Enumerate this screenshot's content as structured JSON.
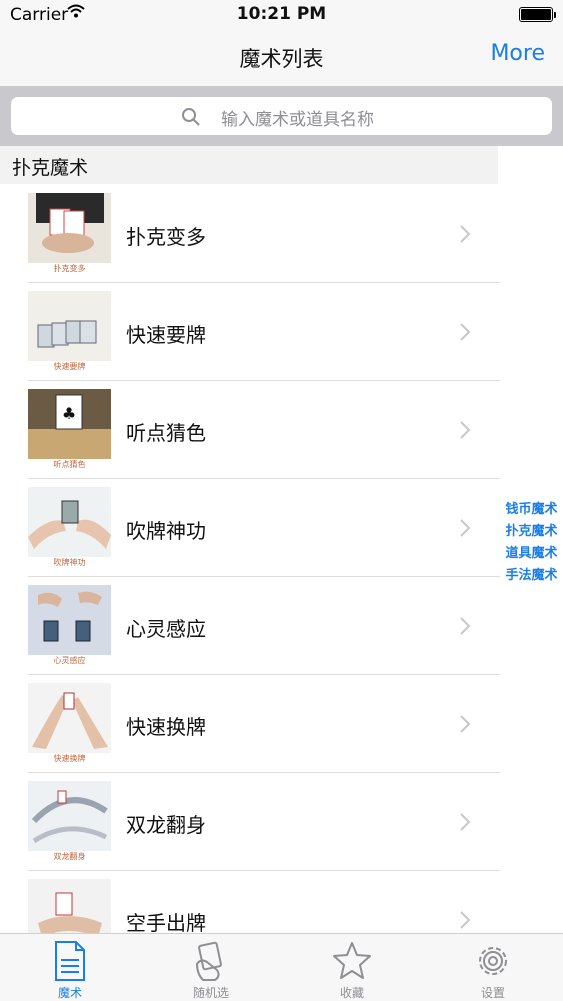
{
  "status": {
    "carrier": "Carrier",
    "time": "10:21 PM"
  },
  "nav": {
    "title": "魔术列表",
    "more": "More"
  },
  "search": {
    "placeholder": "输入魔术或道具名称"
  },
  "section": {
    "title": "扑克魔术"
  },
  "items": [
    {
      "label": "扑克变多",
      "caption": "扑克变多"
    },
    {
      "label": "快速要牌",
      "caption": "快速要牌"
    },
    {
      "label": "听点猜色",
      "caption": "听点猜色"
    },
    {
      "label": "吹牌神功",
      "caption": "吹牌神功"
    },
    {
      "label": "心灵感应",
      "caption": "心灵感应"
    },
    {
      "label": "快速换牌",
      "caption": "快速换牌"
    },
    {
      "label": "双龙翻身",
      "caption": "双龙翻身"
    },
    {
      "label": "空手出牌",
      "caption": ""
    }
  ],
  "index": [
    "钱币魔术",
    "扑克魔术",
    "道具魔术",
    "手法魔术"
  ],
  "tabs": [
    {
      "label": "魔术",
      "icon": "document-icon",
      "active": true
    },
    {
      "label": "随机选",
      "icon": "random-hand-icon",
      "active": false
    },
    {
      "label": "收藏",
      "icon": "star-icon",
      "active": false
    },
    {
      "label": "设置",
      "icon": "gear-icon",
      "active": false
    }
  ],
  "colors": {
    "accent": "#1a7ee6",
    "search_bg": "#c8c8cd",
    "tab_inactive": "#8e8e93"
  }
}
